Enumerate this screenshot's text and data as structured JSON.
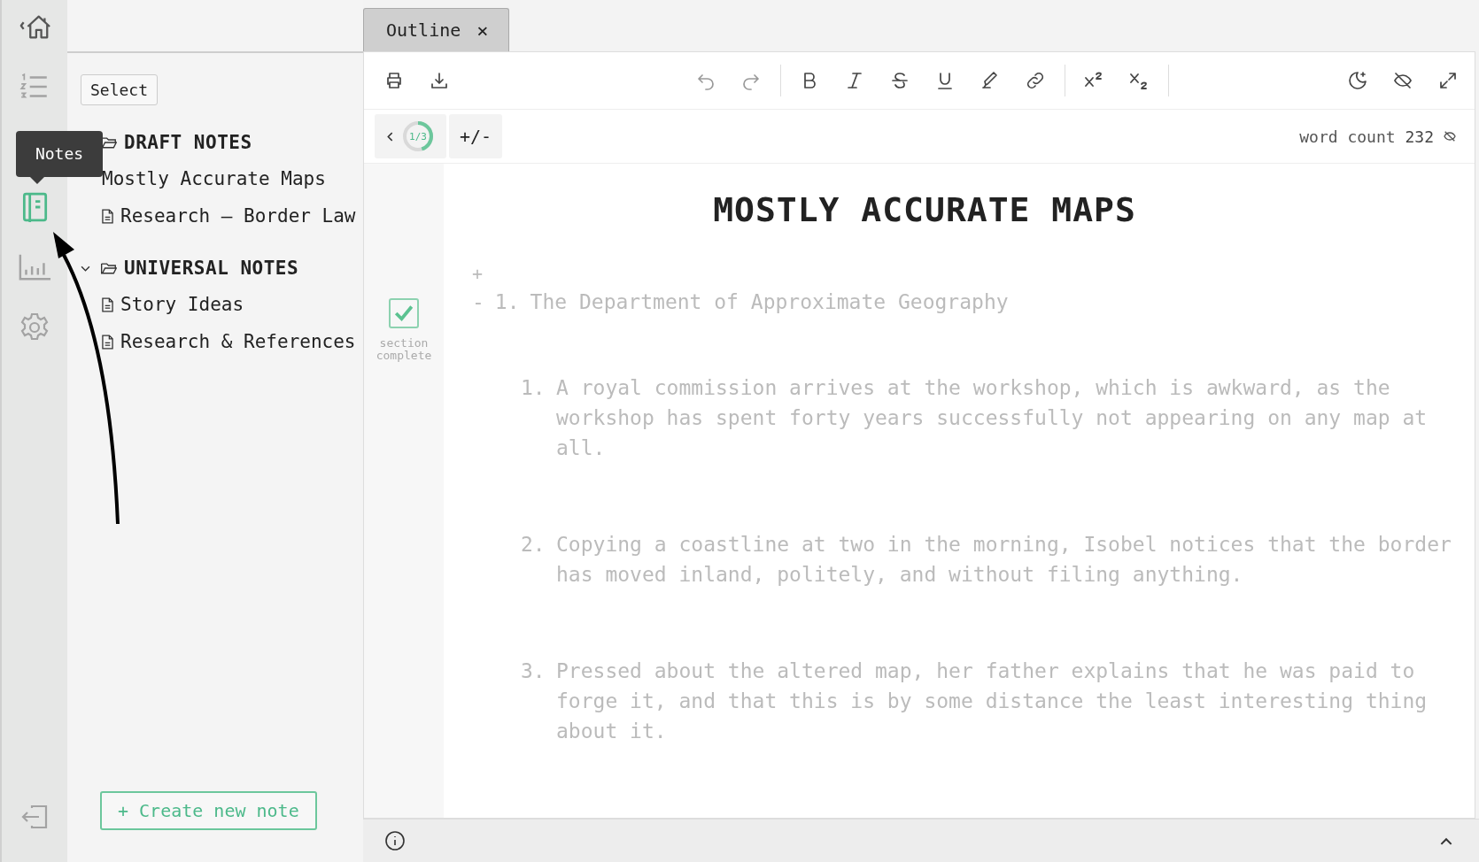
{
  "rail": {
    "items": [
      {
        "kind": "home",
        "selected": false
      },
      {
        "kind": "outline",
        "selected": false
      },
      {
        "kind": "notes",
        "selected": true
      },
      {
        "kind": "stats",
        "selected": false
      },
      {
        "kind": "settings",
        "selected": false
      }
    ],
    "tooltip": "Notes"
  },
  "sidebar": {
    "select_button": "Select",
    "groups": [
      {
        "title": "DRAFT NOTES",
        "expanded": true,
        "items": [
          {
            "label": "Mostly Accurate Maps",
            "kind": "active"
          },
          {
            "label": "Research — Border Law",
            "kind": "doc"
          }
        ]
      },
      {
        "title": "UNIVERSAL NOTES",
        "expanded": true,
        "items": [
          {
            "label": "Story Ideas",
            "kind": "doc"
          },
          {
            "label": "Research & References",
            "kind": "doc"
          }
        ]
      }
    ],
    "create_button": "+ Create new note"
  },
  "tabs": [
    {
      "label": "Outline",
      "close": "×",
      "selected": true
    }
  ],
  "progress": {
    "label": "1/3",
    "level": 0.45
  },
  "toggle_button": "+/-",
  "word_count": {
    "label": "word count",
    "value": "232"
  },
  "document": {
    "title": "MOSTLY ACCURATE MAPS",
    "section": {
      "checked": true,
      "label": "section complete"
    },
    "add_mark": "+",
    "heading": {
      "marker": "-",
      "number": "1.",
      "text": "The Department of Approximate Geography"
    },
    "items": [
      {
        "number": "1.",
        "text": "A royal commission arrives at the workshop, which is awkward, as the workshop has spent forty years successfully not appearing on any map at all."
      },
      {
        "number": "2.",
        "text": "Copying a coastline at two in the morning, Isobel notices that the border has moved inland, politely, and without filing anything."
      },
      {
        "number": "3.",
        "text": "Pressed about the altered map, her father explains that he was paid to forge it, and that this is by some distance the least interesting thing about it."
      }
    ]
  }
}
